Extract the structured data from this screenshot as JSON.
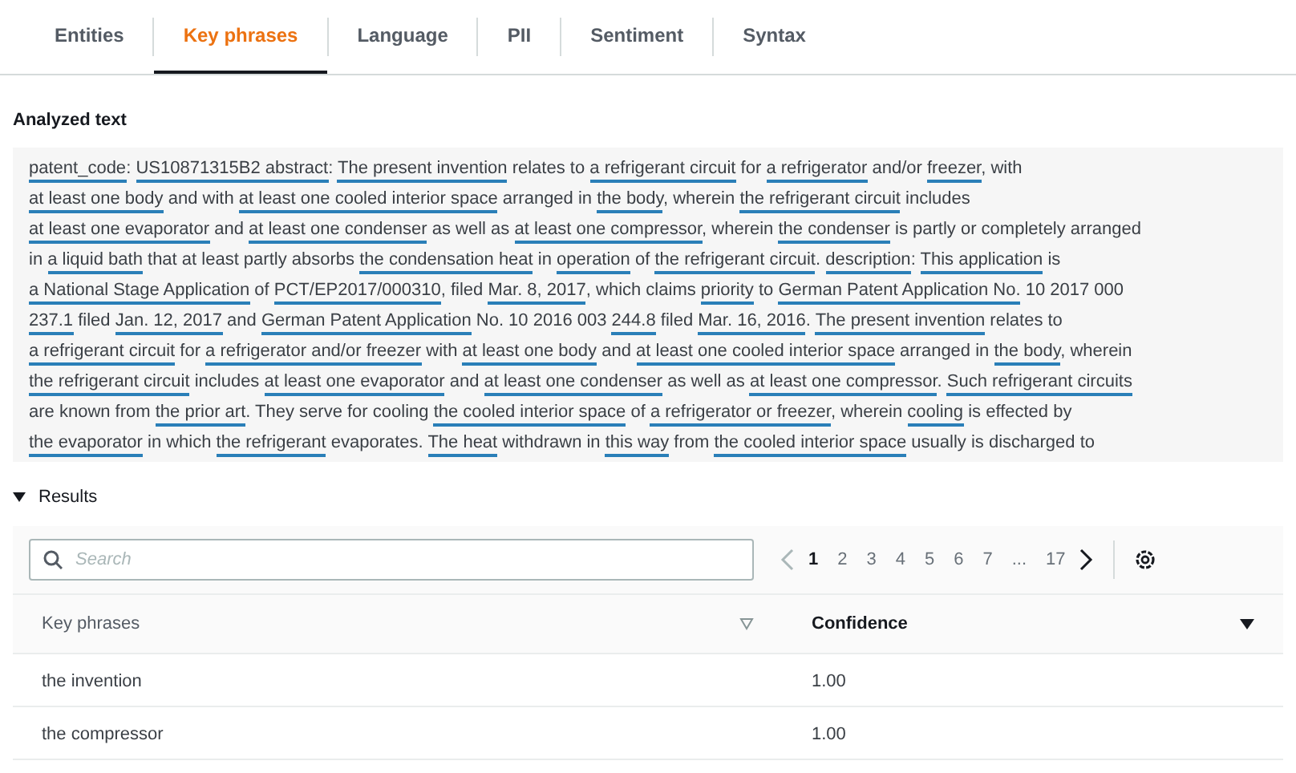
{
  "tabs": [
    {
      "label": "Entities",
      "selected": false
    },
    {
      "label": "Key phrases",
      "selected": true
    },
    {
      "label": "Language",
      "selected": false
    },
    {
      "label": "PII",
      "selected": false
    },
    {
      "label": "Sentiment",
      "selected": false
    },
    {
      "label": "Syntax",
      "selected": false
    }
  ],
  "analyzed_text": {
    "title": "Analyzed text",
    "lines": [
      [
        {
          "text": "patent_code",
          "phrase": true
        },
        {
          "text": ": ",
          "phrase": false
        },
        {
          "text": "US10871315B2 abstract",
          "phrase": true
        },
        {
          "text": ": ",
          "phrase": false
        },
        {
          "text": "The present invention",
          "phrase": true
        },
        {
          "text": " relates to ",
          "phrase": false
        },
        {
          "text": "a refrigerant circuit",
          "phrase": true
        },
        {
          "text": " for ",
          "phrase": false
        },
        {
          "text": "a refrigerator",
          "phrase": true
        },
        {
          "text": " and/or ",
          "phrase": false
        },
        {
          "text": "freezer",
          "phrase": true
        },
        {
          "text": ", with",
          "phrase": false
        }
      ],
      [
        {
          "text": "at least one body",
          "phrase": true
        },
        {
          "text": " and with ",
          "phrase": false
        },
        {
          "text": "at least one cooled interior space",
          "phrase": true
        },
        {
          "text": " arranged in ",
          "phrase": false
        },
        {
          "text": "the body",
          "phrase": true
        },
        {
          "text": ", wherein ",
          "phrase": false
        },
        {
          "text": "the refrigerant circuit",
          "phrase": true
        },
        {
          "text": " includes",
          "phrase": false
        }
      ],
      [
        {
          "text": "at least one evaporator",
          "phrase": true
        },
        {
          "text": " and ",
          "phrase": false
        },
        {
          "text": "at least one condenser",
          "phrase": true
        },
        {
          "text": " as well as ",
          "phrase": false
        },
        {
          "text": "at least one compressor",
          "phrase": true
        },
        {
          "text": ", wherein ",
          "phrase": false
        },
        {
          "text": "the condenser",
          "phrase": true
        },
        {
          "text": " is partly or completely arranged",
          "phrase": false
        }
      ],
      [
        {
          "text": "in ",
          "phrase": false
        },
        {
          "text": "a liquid bath",
          "phrase": true
        },
        {
          "text": " that at least partly absorbs ",
          "phrase": false
        },
        {
          "text": "the condensation heat",
          "phrase": true
        },
        {
          "text": " in ",
          "phrase": false
        },
        {
          "text": "operation",
          "phrase": true
        },
        {
          "text": " of ",
          "phrase": false
        },
        {
          "text": "the refrigerant circuit",
          "phrase": true
        },
        {
          "text": ". ",
          "phrase": false
        },
        {
          "text": "description",
          "phrase": true
        },
        {
          "text": ": ",
          "phrase": false
        },
        {
          "text": "This application",
          "phrase": true
        },
        {
          "text": " is",
          "phrase": false
        }
      ],
      [
        {
          "text": "a National Stage Application",
          "phrase": true
        },
        {
          "text": " of ",
          "phrase": false
        },
        {
          "text": "PCT/EP2017/000310",
          "phrase": true
        },
        {
          "text": ", filed ",
          "phrase": false
        },
        {
          "text": "Mar. 8, 2017",
          "phrase": true
        },
        {
          "text": ", which claims ",
          "phrase": false
        },
        {
          "text": "priority",
          "phrase": true
        },
        {
          "text": " to ",
          "phrase": false
        },
        {
          "text": "German Patent Application No.",
          "phrase": true
        },
        {
          "text": " 10 2017 000",
          "phrase": false
        }
      ],
      [
        {
          "text": "237.1",
          "phrase": true
        },
        {
          "text": " filed ",
          "phrase": false
        },
        {
          "text": "Jan. 12, 2017",
          "phrase": true
        },
        {
          "text": " and ",
          "phrase": false
        },
        {
          "text": "German Patent Application",
          "phrase": true
        },
        {
          "text": " No. 10 2016 003 ",
          "phrase": false
        },
        {
          "text": "244.8",
          "phrase": true
        },
        {
          "text": " filed ",
          "phrase": false
        },
        {
          "text": "Mar. 16, 2016",
          "phrase": true
        },
        {
          "text": ". ",
          "phrase": false
        },
        {
          "text": "The present invention",
          "phrase": true
        },
        {
          "text": " relates to",
          "phrase": false
        }
      ],
      [
        {
          "text": "a refrigerant circuit",
          "phrase": true
        },
        {
          "text": " for ",
          "phrase": false
        },
        {
          "text": "a refrigerator and/or freezer",
          "phrase": true
        },
        {
          "text": " with ",
          "phrase": false
        },
        {
          "text": "at least one body",
          "phrase": true
        },
        {
          "text": " and ",
          "phrase": false
        },
        {
          "text": "at least one cooled interior space",
          "phrase": true
        },
        {
          "text": " arranged in ",
          "phrase": false
        },
        {
          "text": "the body",
          "phrase": true
        },
        {
          "text": ", wherein",
          "phrase": false
        }
      ],
      [
        {
          "text": "the refrigerant circuit",
          "phrase": true
        },
        {
          "text": " includes ",
          "phrase": false
        },
        {
          "text": "at least one evaporator",
          "phrase": true
        },
        {
          "text": " and ",
          "phrase": false
        },
        {
          "text": "at least one condenser",
          "phrase": true
        },
        {
          "text": " as well as ",
          "phrase": false
        },
        {
          "text": "at least one compressor",
          "phrase": true
        },
        {
          "text": ". ",
          "phrase": false
        },
        {
          "text": "Such refrigerant circuits",
          "phrase": true
        }
      ],
      [
        {
          "text": "are known from ",
          "phrase": false
        },
        {
          "text": "the prior art",
          "phrase": true
        },
        {
          "text": ". They serve for cooling ",
          "phrase": false
        },
        {
          "text": "the cooled interior space",
          "phrase": true
        },
        {
          "text": " of ",
          "phrase": false
        },
        {
          "text": "a refrigerator or freezer",
          "phrase": true
        },
        {
          "text": ", wherein ",
          "phrase": false
        },
        {
          "text": "cooling",
          "phrase": true
        },
        {
          "text": " is effected by",
          "phrase": false
        }
      ],
      [
        {
          "text": "the evaporator",
          "phrase": true
        },
        {
          "text": " in which ",
          "phrase": false
        },
        {
          "text": "the refrigerant",
          "phrase": true
        },
        {
          "text": " evaporates. ",
          "phrase": false
        },
        {
          "text": "The heat",
          "phrase": true
        },
        {
          "text": " withdrawn in ",
          "phrase": false
        },
        {
          "text": "this way",
          "phrase": true
        },
        {
          "text": " from ",
          "phrase": false
        },
        {
          "text": "the cooled interior space",
          "phrase": true
        },
        {
          "text": " usually is discharged to",
          "phrase": false
        }
      ]
    ]
  },
  "results": {
    "title": "Results",
    "expanded": true,
    "search": {
      "placeholder": "Search"
    },
    "pages": [
      {
        "label": "1",
        "selected": true
      },
      {
        "label": "2",
        "selected": false
      },
      {
        "label": "3",
        "selected": false
      },
      {
        "label": "4",
        "selected": false
      },
      {
        "label": "5",
        "selected": false
      },
      {
        "label": "6",
        "selected": false
      },
      {
        "label": "7",
        "selected": false
      },
      {
        "label": "...",
        "selected": false
      },
      {
        "label": "17",
        "selected": false
      }
    ],
    "table": {
      "columns": [
        {
          "label": "Key phrases",
          "sorted": false
        },
        {
          "label": "Confidence",
          "sorted": true
        }
      ],
      "rows": [
        [
          "the invention",
          "1.00"
        ],
        [
          "the compressor",
          "1.00"
        ]
      ]
    }
  }
}
